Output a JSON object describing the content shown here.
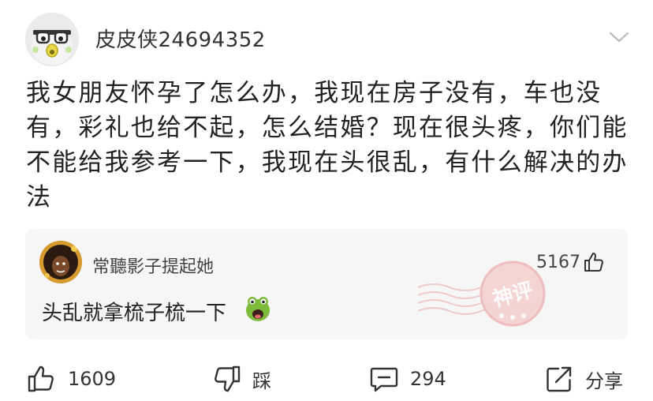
{
  "post": {
    "author": "皮皮侠24694352",
    "body": "我女朋友怀孕了怎么办，我现在房子没有，车也没有，彩礼也给不起，怎么结婚？现在很头疼，你们能不能给我参考一下，我现在头很乱，有什么解决的办法"
  },
  "god_comment": {
    "author": "常聽影子提起她",
    "likes": "5167",
    "text": "头乱就拿梳子梳一下",
    "stamp_text": "神评"
  },
  "actions": {
    "like_count": "1609",
    "dislike_label": "踩",
    "comment_count": "294",
    "share_label": "分享"
  },
  "icons": [
    "avatar",
    "chevron-down-icon",
    "thumb-up-icon",
    "thumb-down-icon",
    "comment-icon",
    "share-icon",
    "frog-emoji-icon",
    "god-comment-stamp"
  ],
  "colors": {
    "accent_red": "#e46a6a",
    "comment_bg": "#f6f6f6",
    "text": "#222222"
  }
}
